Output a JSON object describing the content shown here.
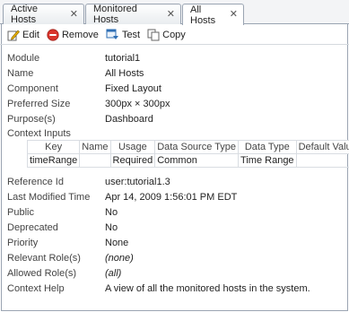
{
  "tabs": [
    {
      "label": "Active Hosts",
      "active": false
    },
    {
      "label": "Monitored Hosts",
      "active": false
    },
    {
      "label": "All Hosts",
      "active": true
    }
  ],
  "tab_close_glyph": "✕",
  "toolbar": {
    "edit_label": "Edit",
    "remove_label": "Remove",
    "test_label": "Test",
    "copy_label": "Copy"
  },
  "properties": {
    "module": {
      "label": "Module",
      "value": "tutorial1"
    },
    "name": {
      "label": "Name",
      "value": "All Hosts"
    },
    "component": {
      "label": "Component",
      "value": "Fixed Layout"
    },
    "preferred_size": {
      "label": "Preferred Size",
      "value": "300px × 300px"
    },
    "purposes": {
      "label": "Purpose(s)",
      "value": "Dashboard"
    },
    "context_inputs_label": "Context Inputs",
    "reference_id": {
      "label": "Reference Id",
      "value": "user:tutorial1.3"
    },
    "last_modified": {
      "label": "Last Modified Time",
      "value": "Apr 14, 2009 1:56:01 PM EDT"
    },
    "public": {
      "label": "Public",
      "value": "No"
    },
    "deprecated": {
      "label": "Deprecated",
      "value": "No"
    },
    "priority": {
      "label": "Priority",
      "value": "None"
    },
    "relevant_roles": {
      "label": "Relevant Role(s)",
      "value": "(none)"
    },
    "allowed_roles": {
      "label": "Allowed Role(s)",
      "value": "(all)"
    },
    "context_help": {
      "label": "Context Help",
      "value": "A view of all the monitored hosts in the system."
    }
  },
  "context_inputs": {
    "headers": [
      "Key",
      "Name",
      "Usage",
      "Data Source Type",
      "Data Type",
      "Default Value"
    ],
    "rows": [
      [
        "timeRange",
        "",
        "Required",
        "Common",
        "Time Range",
        ""
      ]
    ]
  },
  "colors": {
    "border": "#9aa4b2",
    "remove_red": "#d9342b",
    "edit_accent": "#e0a400",
    "test_blue": "#2f6fb5"
  }
}
